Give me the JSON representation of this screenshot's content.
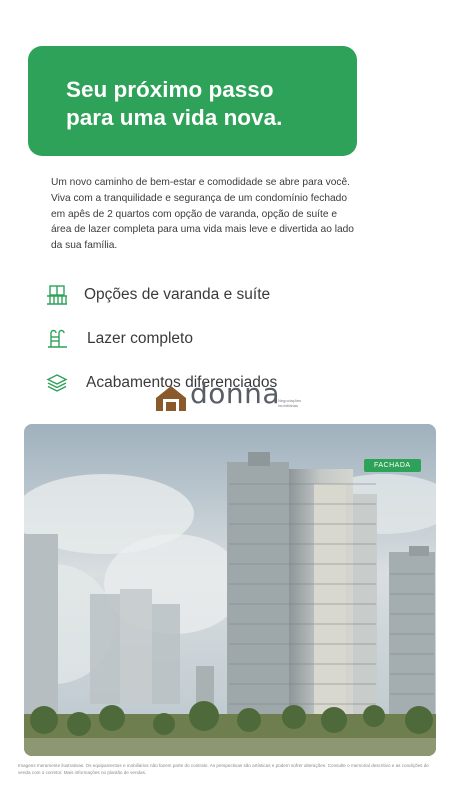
{
  "hero": {
    "title": "Seu próximo passo\npara uma vida nova."
  },
  "intro": "Um novo caminho de bem-estar e comodidade se abre para você. Viva com a tranquilidade e segurança de um condomínio fechado em apês de 2 quartos com opção de varanda, opção de suíte e área de lazer completa para uma vida mais leve e divertida ao lado da sua família.",
  "features": [
    {
      "label": "Opções de varanda e suíte",
      "icon": "balcony-icon"
    },
    {
      "label": "Lazer completo",
      "icon": "pool-ladder-icon"
    },
    {
      "label": "Acabamentos diferenciados",
      "icon": "layers-icon"
    }
  ],
  "logo": {
    "text": "donna",
    "tagline": "Negociações imobiliárias"
  },
  "photo": {
    "tag": "FACHADA"
  },
  "disclaimer": "Imagens meramente ilustrativas. Os equipamentos e mobiliários não fazem parte do contrato. As perspectivas são artísticas e podem sofrer alterações. Consulte o memorial descritivo e as condições de venda com o corretor. Mais informações no plantão de vendas.",
  "colors": {
    "brand_green": "#2ea259"
  }
}
